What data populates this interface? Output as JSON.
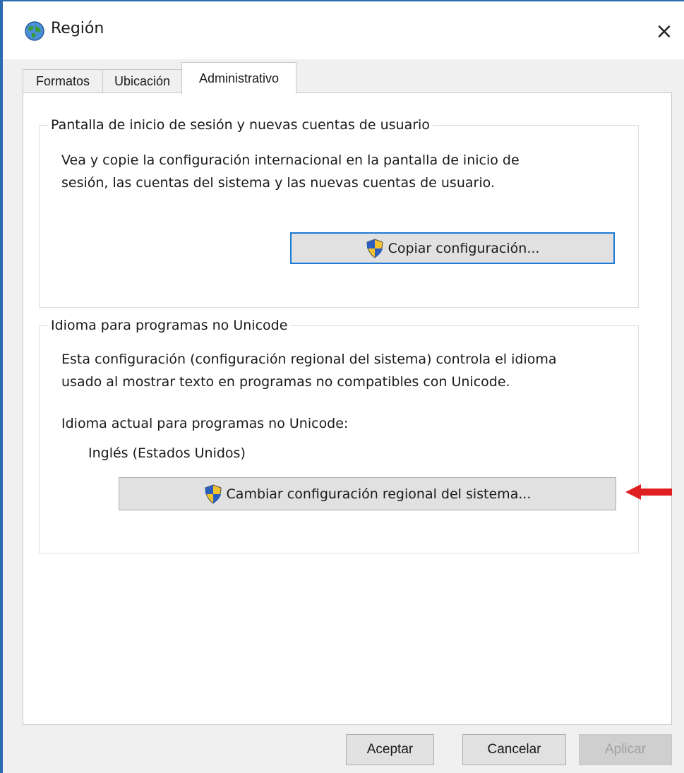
{
  "window": {
    "title": "Región",
    "close_label": "×"
  },
  "tabs": [
    {
      "label": "Formatos",
      "active": false
    },
    {
      "label": "Ubicación",
      "active": false
    },
    {
      "label": "Administrativo",
      "active": true
    }
  ],
  "group_login": {
    "legend": "Pantalla de inicio de sesión y nuevas cuentas de usuario",
    "description_line1": "Vea y copie la configuración internacional en la pantalla de inicio de",
    "description_line2": "sesión, las cuentas del sistema y las nuevas cuentas de usuario.",
    "copy_button_label": "Copiar configuración..."
  },
  "group_unicode": {
    "legend": "Idioma para programas no Unicode",
    "description_line1": "Esta configuración (configuración regional del sistema) controla el idioma",
    "description_line2": "usado al mostrar texto en programas no compatibles con Unicode.",
    "current_label": "Idioma actual para programas no Unicode:",
    "current_value": "Inglés (Estados Unidos)",
    "change_button_label": "Cambiar configuración regional del sistema..."
  },
  "footer": {
    "ok_label": "Aceptar",
    "cancel_label": "Cancelar",
    "apply_label": "Aplicar"
  },
  "icons": {
    "window": "globe-icon",
    "shield": "uac-shield-icon",
    "annotation": "red-arrow-icon"
  },
  "colors": {
    "focus_border": "#1f7bd2",
    "annotation_arrow": "#e02020",
    "window_border": "#2b6cb0"
  }
}
